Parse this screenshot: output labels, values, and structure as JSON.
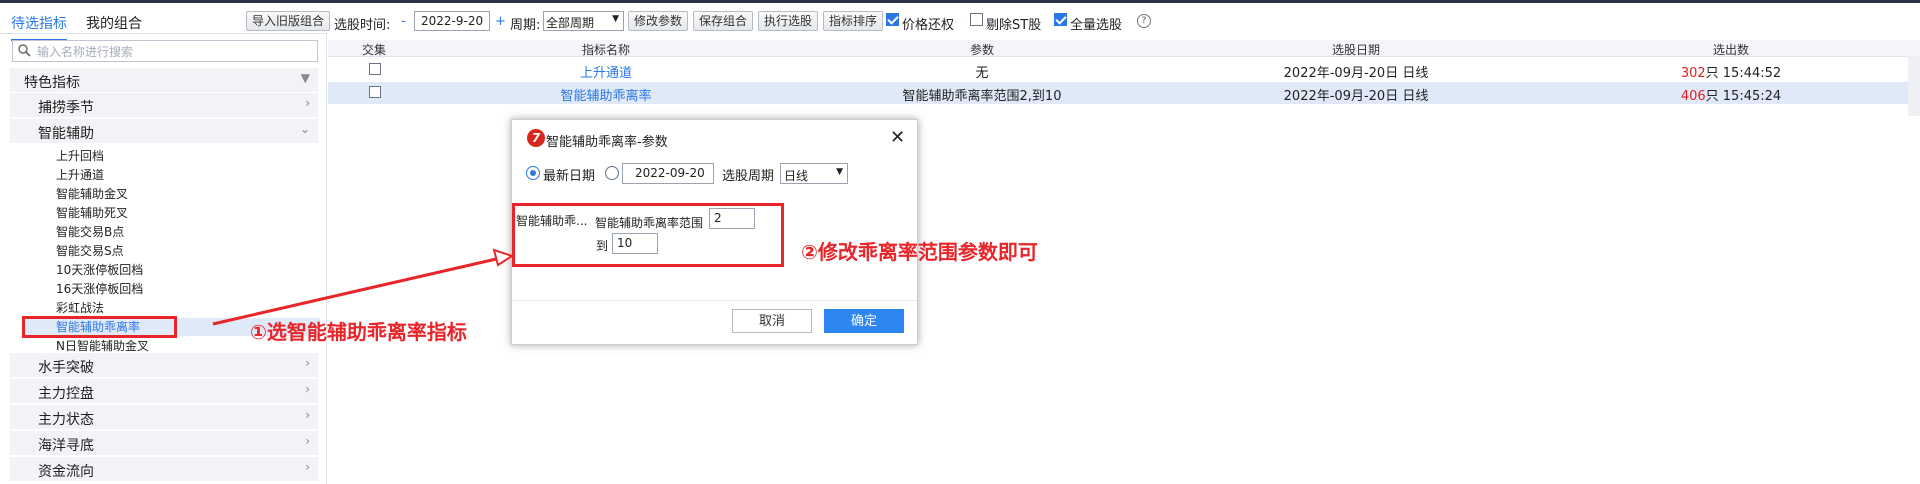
{
  "left_panel": {
    "tabs": [
      "待选指标",
      "我的组合"
    ],
    "search_placeholder": "输入名称进行搜索",
    "root_category": "特色指标",
    "categories_top": [
      "捕捞季节",
      "智能辅助"
    ],
    "leaves": [
      "上升回档",
      "上升通道",
      "智能辅助金叉",
      "智能辅助死叉",
      "智能交易B点",
      "智能交易S点",
      "10天涨停板回档",
      "16天涨停板回档",
      "彩虹战法",
      "智能辅助乖离率",
      "N日智能辅助金叉"
    ],
    "selected_leaf": "智能辅助乖离率",
    "categories_bottom": [
      "水手突破",
      "主力控盘",
      "主力状态",
      "海洋寻底",
      "资金流向"
    ]
  },
  "toolbar": {
    "import_btn": "导入旧版组合",
    "date_label": "选股时间:",
    "minus": "-",
    "date_value": "2022-9-20",
    "plus": "+",
    "period_label": "周期:",
    "period_value": "全部周期",
    "modify_btn": "修改参数",
    "save_btn": "保存组合",
    "exec_btn": "执行选股",
    "sort_btn": "指标排序",
    "opt1_label": "价格还权",
    "opt1_checked": true,
    "opt2_label": "剔除ST股",
    "opt2_checked": false,
    "opt3_label": "全量选股",
    "opt3_checked": true,
    "help_icon": "?"
  },
  "table": {
    "headers": [
      "交集",
      "指标名称",
      "参数",
      "选股日期",
      "选出数"
    ],
    "rows": [
      {
        "name": "上升通道",
        "param": "无",
        "date": "2022年-09月-20日 日线",
        "count": "302",
        "count_suffix": "只 15:44:52"
      },
      {
        "name": "智能辅助乖离率",
        "param": "智能辅助乖离率范围2,到10",
        "date": "2022年-09月-20日 日线",
        "count": "406",
        "count_suffix": "只 15:45:24"
      }
    ]
  },
  "dialog": {
    "logo": "7",
    "title": "智能辅助乖离率-参数",
    "close": "✕",
    "radio_latest": "最新日期",
    "date_value": "2022-09-20",
    "period_label": "选股周期",
    "period_value": "日线",
    "group_label": "智能辅助乖...",
    "range_label": "智能辅助乖离率范围",
    "range_from": "2",
    "to_label": "到",
    "range_to": "10",
    "cancel": "取消",
    "ok": "确定"
  },
  "annotations": {
    "step1": "①选智能辅助乖离率指标",
    "step2": "②修改乖离率范围参数即可"
  },
  "colors": {
    "accent": "#2b78e4",
    "annotation_red": "#e8262a",
    "count_red": "#e02020",
    "ok_button": "#2e86f0"
  }
}
